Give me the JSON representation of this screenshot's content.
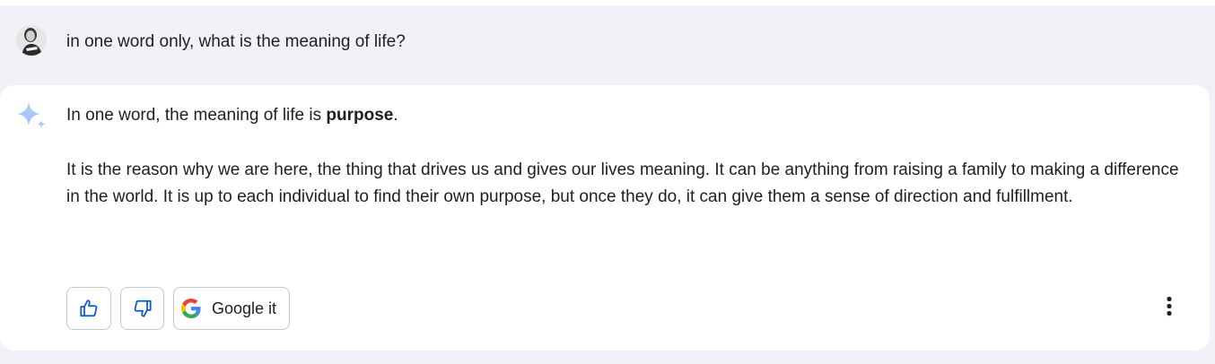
{
  "prompt": {
    "text": "in one word only, what is the meaning of life?"
  },
  "response": {
    "line1_prefix": "In one word, the meaning of life is ",
    "line1_bold": "purpose",
    "line1_suffix": ".",
    "paragraph": "It is the reason why we are here, the thing that drives us and gives our lives meaning. It can be anything from raising a family to making a difference in the world. It is up to each individual to find their own purpose, but once they do, it can give them a sense of direction and fulfillment."
  },
  "actions": {
    "thumbs_up_icon": "thumbs-up-icon",
    "thumbs_down_icon": "thumbs-down-icon",
    "google_it_label": "Google it",
    "more_icon": "more-vertical-icon"
  },
  "colors": {
    "background": "#f0f2f7",
    "card": "#ffffff",
    "sparkle": "#a8c7fa",
    "button_border": "#c7c7c7",
    "icon": "#0b57d0"
  }
}
